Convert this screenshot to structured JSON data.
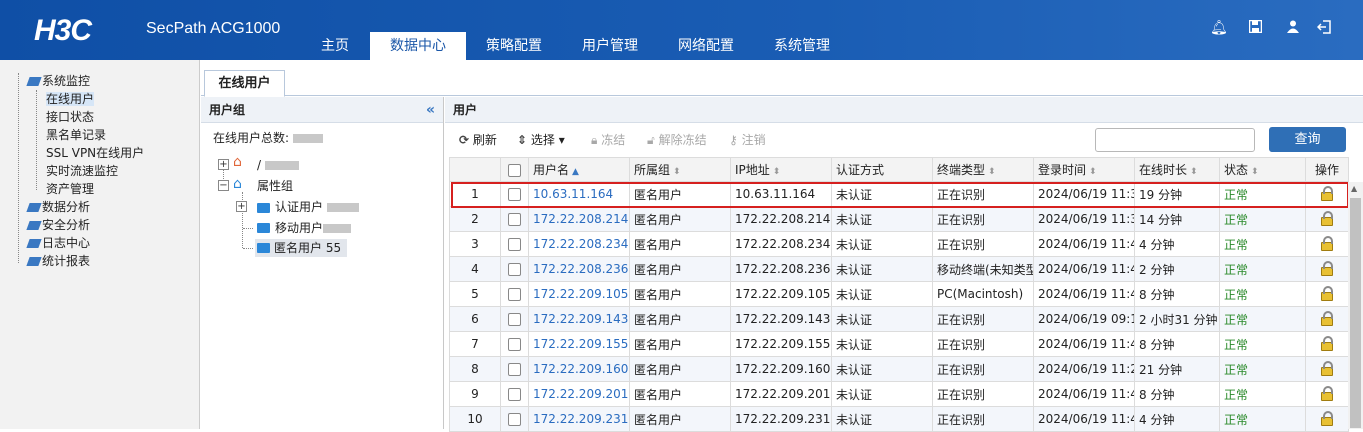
{
  "header": {
    "logo": "H3C",
    "product": "SecPath ACG1000",
    "nav": [
      "主页",
      "数据中心",
      "策略配置",
      "用户管理",
      "网络配置",
      "系统管理"
    ],
    "active_nav": "数据中心",
    "icons": [
      "bell-icon",
      "save-icon",
      "user-icon",
      "logout-icon"
    ]
  },
  "leftnav": {
    "items": [
      {
        "label": "系统监控",
        "level": 0
      },
      {
        "label": "在线用户",
        "level": 1,
        "selected": true
      },
      {
        "label": "接口状态",
        "level": 1
      },
      {
        "label": "黑名单记录",
        "level": 1
      },
      {
        "label": "SSL VPN在线用户",
        "level": 1
      },
      {
        "label": "实时流速监控",
        "level": 1
      },
      {
        "label": "资产管理",
        "level": 1
      },
      {
        "label": "数据分析",
        "level": 0
      },
      {
        "label": "安全分析",
        "level": 0
      },
      {
        "label": "日志中心",
        "level": 0
      },
      {
        "label": "统计报表",
        "level": 0
      }
    ]
  },
  "tab": {
    "label": "在线用户"
  },
  "group_panel": {
    "title": "用户组",
    "collapse": "«",
    "total_label": "在线用户总数:",
    "tree": {
      "root": "/",
      "attr_group": "属性组",
      "auth_user": "认证用户",
      "mobile_user": "移动用户",
      "anon_user": "匿名用户 55"
    }
  },
  "user_panel": {
    "title": "用户",
    "toolbar": {
      "refresh": "刷新",
      "select": "选择",
      "freeze": "冻结",
      "unfreeze": "解除冻结",
      "logout": "注销"
    },
    "search": {
      "value": "",
      "button": "查询"
    },
    "columns": [
      "用户名",
      "所属组",
      "IP地址",
      "认证方式",
      "终端类型",
      "登录时间",
      "在线时长",
      "状态",
      "操作"
    ],
    "rows": [
      {
        "n": "1",
        "user": "10.63.11.164",
        "group": "匿名用户",
        "ip": "10.63.11.164",
        "auth": "未认证",
        "term": "正在识别",
        "login": "2024/06/19 11:3",
        "dur": "19 分钟",
        "status": "正常"
      },
      {
        "n": "2",
        "user": "172.22.208.214",
        "group": "匿名用户",
        "ip": "172.22.208.214",
        "auth": "未认证",
        "term": "正在识别",
        "login": "2024/06/19 11:3",
        "dur": "14 分钟",
        "status": "正常"
      },
      {
        "n": "3",
        "user": "172.22.208.234",
        "group": "匿名用户",
        "ip": "172.22.208.234",
        "auth": "未认证",
        "term": "正在识别",
        "login": "2024/06/19 11:4",
        "dur": "4 分钟",
        "status": "正常"
      },
      {
        "n": "4",
        "user": "172.22.208.236",
        "group": "匿名用户",
        "ip": "172.22.208.236",
        "auth": "未认证",
        "term": "移动终端(未知类型",
        "login": "2024/06/19 11:4",
        "dur": "2 分钟",
        "status": "正常"
      },
      {
        "n": "5",
        "user": "172.22.209.105",
        "group": "匿名用户",
        "ip": "172.22.209.105",
        "auth": "未认证",
        "term": "PC(Macintosh)",
        "login": "2024/06/19 11:4",
        "dur": "8 分钟",
        "status": "正常"
      },
      {
        "n": "6",
        "user": "172.22.209.143",
        "group": "匿名用户",
        "ip": "172.22.209.143",
        "auth": "未认证",
        "term": "正在识别",
        "login": "2024/06/19 09:1",
        "dur": "2 小时31 分钟",
        "status": "正常"
      },
      {
        "n": "7",
        "user": "172.22.209.155",
        "group": "匿名用户",
        "ip": "172.22.209.155",
        "auth": "未认证",
        "term": "正在识别",
        "login": "2024/06/19 11:4",
        "dur": "8 分钟",
        "status": "正常"
      },
      {
        "n": "8",
        "user": "172.22.209.160",
        "group": "匿名用户",
        "ip": "172.22.209.160",
        "auth": "未认证",
        "term": "正在识别",
        "login": "2024/06/19 11:2",
        "dur": "21 分钟",
        "status": "正常"
      },
      {
        "n": "9",
        "user": "172.22.209.201",
        "group": "匿名用户",
        "ip": "172.22.209.201",
        "auth": "未认证",
        "term": "正在识别",
        "login": "2024/06/19 11:4",
        "dur": "8 分钟",
        "status": "正常"
      },
      {
        "n": "10",
        "user": "172.22.209.231",
        "group": "匿名用户",
        "ip": "172.22.209.231",
        "auth": "未认证",
        "term": "正在识别",
        "login": "2024/06/19 11:4",
        "dur": "4 分钟",
        "status": "正常"
      }
    ]
  },
  "colors": {
    "header": "#1a5db4",
    "accent": "#2f6fb6",
    "highlight": "#d6201f",
    "ok": "#2a8a2a"
  }
}
